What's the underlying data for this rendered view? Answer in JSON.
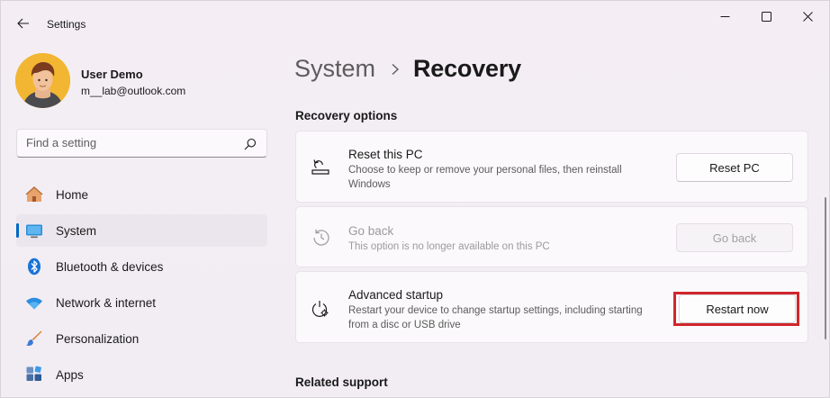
{
  "window": {
    "title": "Settings",
    "controls": {
      "minimize": "minimize-icon",
      "maximize": "maximize-icon",
      "close": "close-icon"
    }
  },
  "user": {
    "name": "User Demo",
    "email": "m__lab@outlook.com"
  },
  "search": {
    "placeholder": "Find a setting"
  },
  "nav": {
    "items": [
      {
        "label": "Home",
        "icon": "home-icon"
      },
      {
        "label": "System",
        "icon": "display-icon",
        "active": true
      },
      {
        "label": "Bluetooth & devices",
        "icon": "bluetooth-icon"
      },
      {
        "label": "Network & internet",
        "icon": "wifi-icon"
      },
      {
        "label": "Personalization",
        "icon": "brush-icon"
      },
      {
        "label": "Apps",
        "icon": "apps-icon"
      }
    ]
  },
  "header": {
    "parent": "System",
    "current": "Recovery"
  },
  "sections": {
    "recovery_options": "Recovery options",
    "related_support": "Related support"
  },
  "cards": [
    {
      "title": "Reset this PC",
      "description": "Choose to keep or remove your personal files, then reinstall Windows",
      "button": "Reset PC",
      "icon": "reset-pc-icon",
      "enabled": true
    },
    {
      "title": "Go back",
      "description": "This option is no longer available on this PC",
      "button": "Go back",
      "icon": "history-icon",
      "enabled": false
    },
    {
      "title": "Advanced startup",
      "description": "Restart your device to change startup settings, including starting from a disc or USB drive",
      "button": "Restart now",
      "icon": "advanced-startup-icon",
      "enabled": true,
      "highlighted": true
    }
  ],
  "colors": {
    "accent": "#0067c0",
    "highlight": "#d0262c",
    "background": "#f3eef3"
  }
}
